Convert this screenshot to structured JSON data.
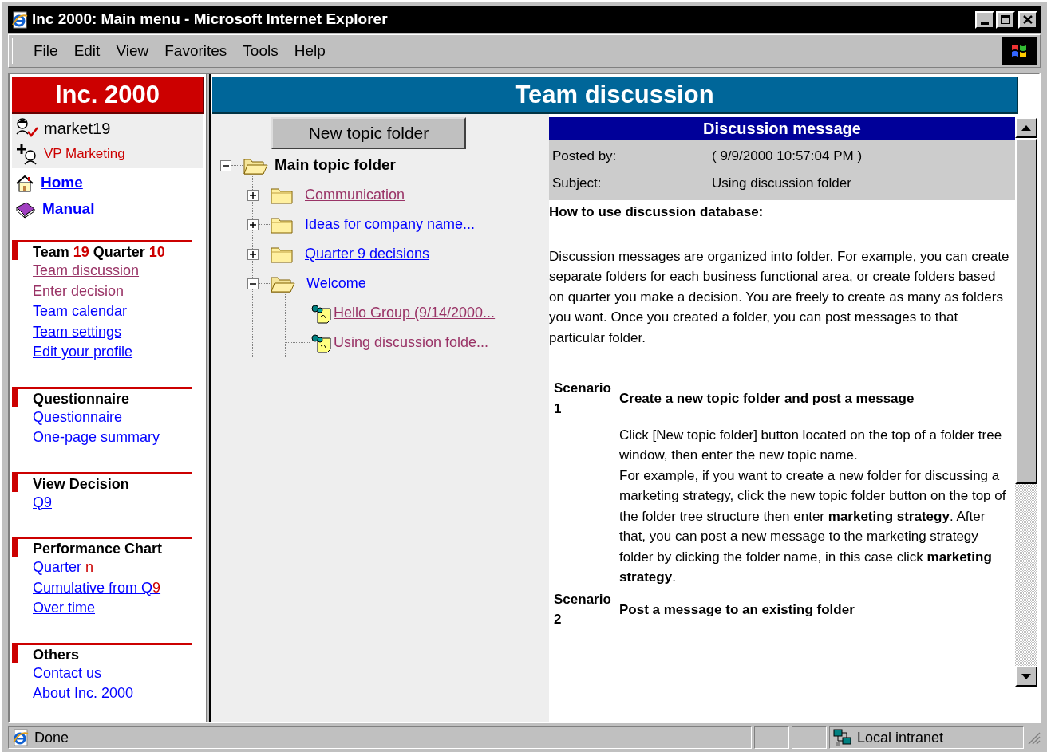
{
  "window": {
    "title": "Inc 2000: Main menu - Microsoft Internet Explorer"
  },
  "menu_bar": [
    "File",
    "Edit",
    "View",
    "Favorites",
    "Tools",
    "Help"
  ],
  "sidebar": {
    "brand": "Inc. 2000",
    "user": "market19",
    "role": "VP Marketing",
    "nav": [
      {
        "label": "Home",
        "kind": "home"
      },
      {
        "label": "Manual",
        "kind": "manual"
      }
    ],
    "sections": [
      {
        "title": [
          {
            "text": "Team ",
            "highlight": false
          },
          {
            "text": "19",
            "highlight": true
          },
          {
            "text": " Quarter ",
            "highlight": false
          },
          {
            "text": "10",
            "highlight": true
          }
        ],
        "links": [
          {
            "label": "Team discussion",
            "visited": true
          },
          {
            "label": "Enter decision",
            "visited": true
          },
          {
            "label": "Team calendar",
            "visited": false
          },
          {
            "label": "Team settings",
            "visited": false
          },
          {
            "label": "Edit your profile",
            "visited": false
          }
        ]
      },
      {
        "title": [
          {
            "text": "Questionnaire",
            "highlight": false
          }
        ],
        "links": [
          {
            "label": "Questionnaire",
            "visited": false
          },
          {
            "label": "One-page summary",
            "visited": false
          }
        ]
      },
      {
        "title": [
          {
            "text": "View Decision",
            "highlight": false
          }
        ],
        "links": [
          {
            "label": "Q9",
            "visited": false
          }
        ]
      },
      {
        "title": [
          {
            "text": "Performance Chart",
            "highlight": false
          }
        ],
        "links": [
          {
            "parts": [
              {
                "text": "Quarter ",
                "highlight": false
              },
              {
                "text": "n",
                "highlight": true
              }
            ],
            "visited": false
          },
          {
            "parts": [
              {
                "text": "Cumulative from Q",
                "highlight": false
              },
              {
                "text": "9",
                "highlight": true
              }
            ],
            "visited": false
          },
          {
            "label": "Over time",
            "visited": false
          }
        ]
      },
      {
        "title": [
          {
            "text": "Others",
            "highlight": false
          }
        ],
        "links": [
          {
            "label": "Contact us",
            "visited": false
          },
          {
            "label": "About Inc. 2000",
            "visited": false
          }
        ]
      }
    ]
  },
  "page_title": "Team discussion",
  "new_folder_button": "New topic folder",
  "tree": {
    "label": "Main topic folder",
    "expanded": true,
    "children": [
      {
        "label": "Communication",
        "kind": "folder",
        "expanded": false,
        "visited": true
      },
      {
        "label": "Ideas for company name...",
        "kind": "folder",
        "expanded": false,
        "visited": false
      },
      {
        "label": "Quarter 9 decisions",
        "kind": "folder",
        "expanded": false,
        "visited": false
      },
      {
        "label": "Welcome",
        "kind": "folder",
        "expanded": true,
        "visited": false,
        "children": [
          {
            "label": "Hello Group (9/14/2000...",
            "kind": "message",
            "visited": true
          },
          {
            "label": "Using discussion folde...",
            "kind": "message",
            "visited": true
          }
        ]
      }
    ]
  },
  "message": {
    "title": "Discussion message",
    "fields": [
      {
        "label": "Posted by:",
        "value": "( 9/9/2000 10:57:04 PM )"
      },
      {
        "label": "Subject:",
        "value": "Using discussion folder"
      }
    ],
    "heading": "How to use discussion database:",
    "intro": "Discussion messages are organized into folder. For example, you can create separate folders for each business functional area, or create folders based on quarter you make a decision. You are freely to create as many as folders you want. Once you created a folder, you can post messages to that particular folder.",
    "scenarios": [
      {
        "label": "Scenario 1",
        "title": "Create a new topic folder and post a message",
        "paragraphs": [
          "Click [New topic folder] button located on the top of a folder tree window, then enter the new topic name.",
          "For example, if you want to create a new folder for discussing a marketing strategy, click the new topic folder button on the top of the folder tree structure then enter **marketing strategy**. After that, you can post a new message to the marketing strategy folder by clicking  the folder name, in this case click **marketing strategy**."
        ]
      },
      {
        "label": "Scenario 2",
        "title": "Post a message to an existing folder"
      }
    ]
  },
  "status_bar": {
    "text": "Done",
    "zone": "Local intranet"
  }
}
